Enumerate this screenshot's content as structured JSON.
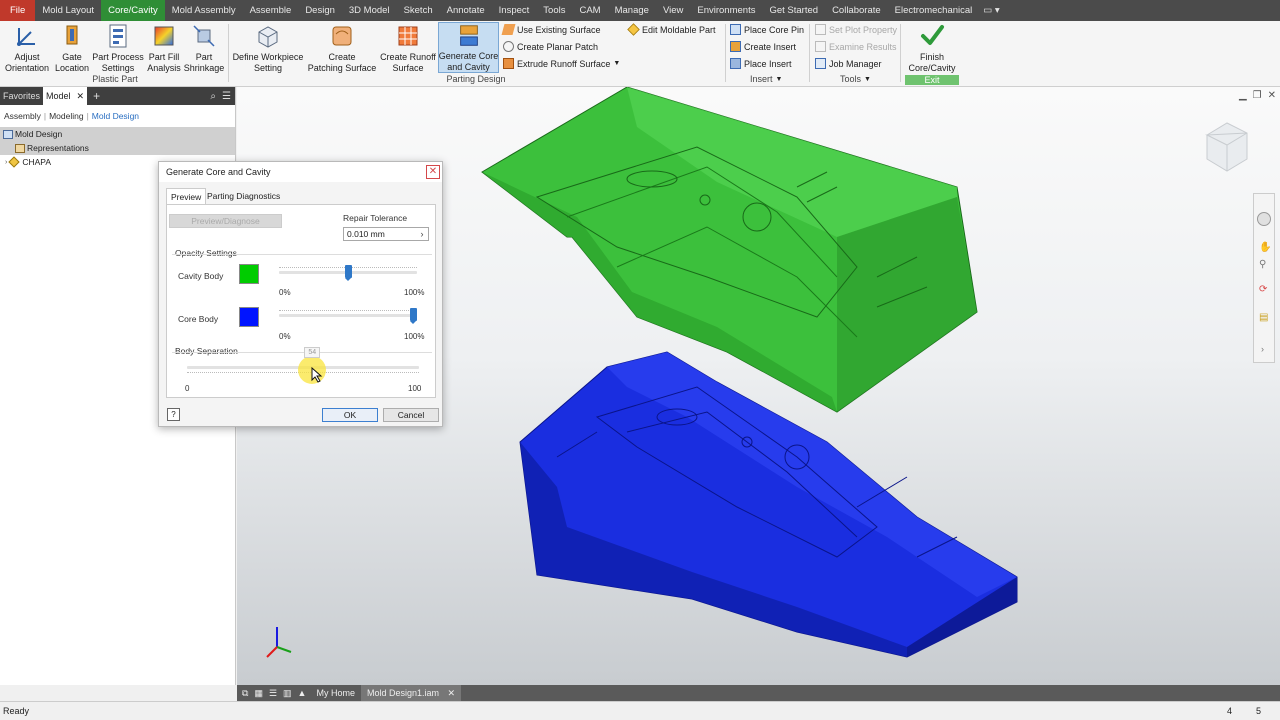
{
  "menu_tabs": [
    "File",
    "Mold Layout",
    "Core/Cavity",
    "Mold Assembly",
    "Assemble",
    "Design",
    "3D Model",
    "Sketch",
    "Annotate",
    "Inspect",
    "Tools",
    "CAM",
    "Manage",
    "View",
    "Environments",
    "Get Started",
    "Collaborate",
    "Electromechanical"
  ],
  "active_menu_tab": "Core/Cavity",
  "ribbon": {
    "adjust_orientation": "Adjust\nOrientation",
    "gate_location": "Gate\nLocation",
    "part_process_settings": "Part Process\nSettings",
    "part_fill_analysis": "Part Fill\nAnalysis",
    "part_shrinkage": "Part\nShrinkage",
    "plastic_part_label": "Plastic Part",
    "define_workpiece": "Define Workpiece\nSetting",
    "create_patching_surface": "Create\nPatching Surface",
    "create_runoff_surface": "Create Runoff\nSurface",
    "generate_core_cavity": "Generate Core\nand Cavity",
    "use_existing_surface": "Use Existing Surface",
    "create_planar_patch": "Create Planar Patch",
    "extrude_runoff_surface": "Extrude Runoff Surface",
    "edit_moldable_part": "Edit Moldable Part",
    "parting_design_label": "Parting Design",
    "place_core_pin": "Place Core Pin",
    "create_insert": "Create Insert",
    "place_insert": "Place Insert",
    "insert_label": "Insert",
    "set_plot_property": "Set Plot Property",
    "examine_results": "Examine Results",
    "job_manager": "Job Manager",
    "tools_label": "Tools",
    "finish_core_cavity": "Finish\nCore/Cavity",
    "exit_label": "Exit"
  },
  "browser": {
    "tab_favorites": "Favorites",
    "tab_model": "Model",
    "sub_assembly": "Assembly",
    "sub_modeling": "Modeling",
    "sub_mold_design": "Mold Design",
    "tree": [
      "Mold Design",
      "Representations",
      "CHAPA"
    ]
  },
  "dialog": {
    "title": "Generate Core and Cavity",
    "tab_preview": "Preview",
    "tab_parting_diagnostics": "Parting Diagnostics",
    "preview_diagnose_button": "Preview/Diagnose",
    "repair_tolerance_label": "Repair Tolerance",
    "repair_tolerance_value": "0.010 mm",
    "opacity_settings_label": "Opacity Settings",
    "cavity_body_label": "Cavity Body",
    "core_body_label": "Core Body",
    "min_pct": "0%",
    "max_pct": "100%",
    "cavity_opacity": 0.5,
    "core_opacity": 0.97,
    "body_separation_label": "Body Separation",
    "separation_min": "0",
    "separation_max": "100",
    "separation_value": 54,
    "separation_tooltip": "54",
    "ok": "OK",
    "cancel": "Cancel"
  },
  "colors": {
    "cavity": "#00cc00",
    "core": "#0014ff",
    "active_tab": "#2f8e36",
    "exit": "#6fc36f"
  },
  "doc_tabs": {
    "my_home": "My Home",
    "document": "Mold Design1.iam"
  },
  "status": {
    "text": "Ready",
    "count_a": "4",
    "count_b": "5"
  }
}
